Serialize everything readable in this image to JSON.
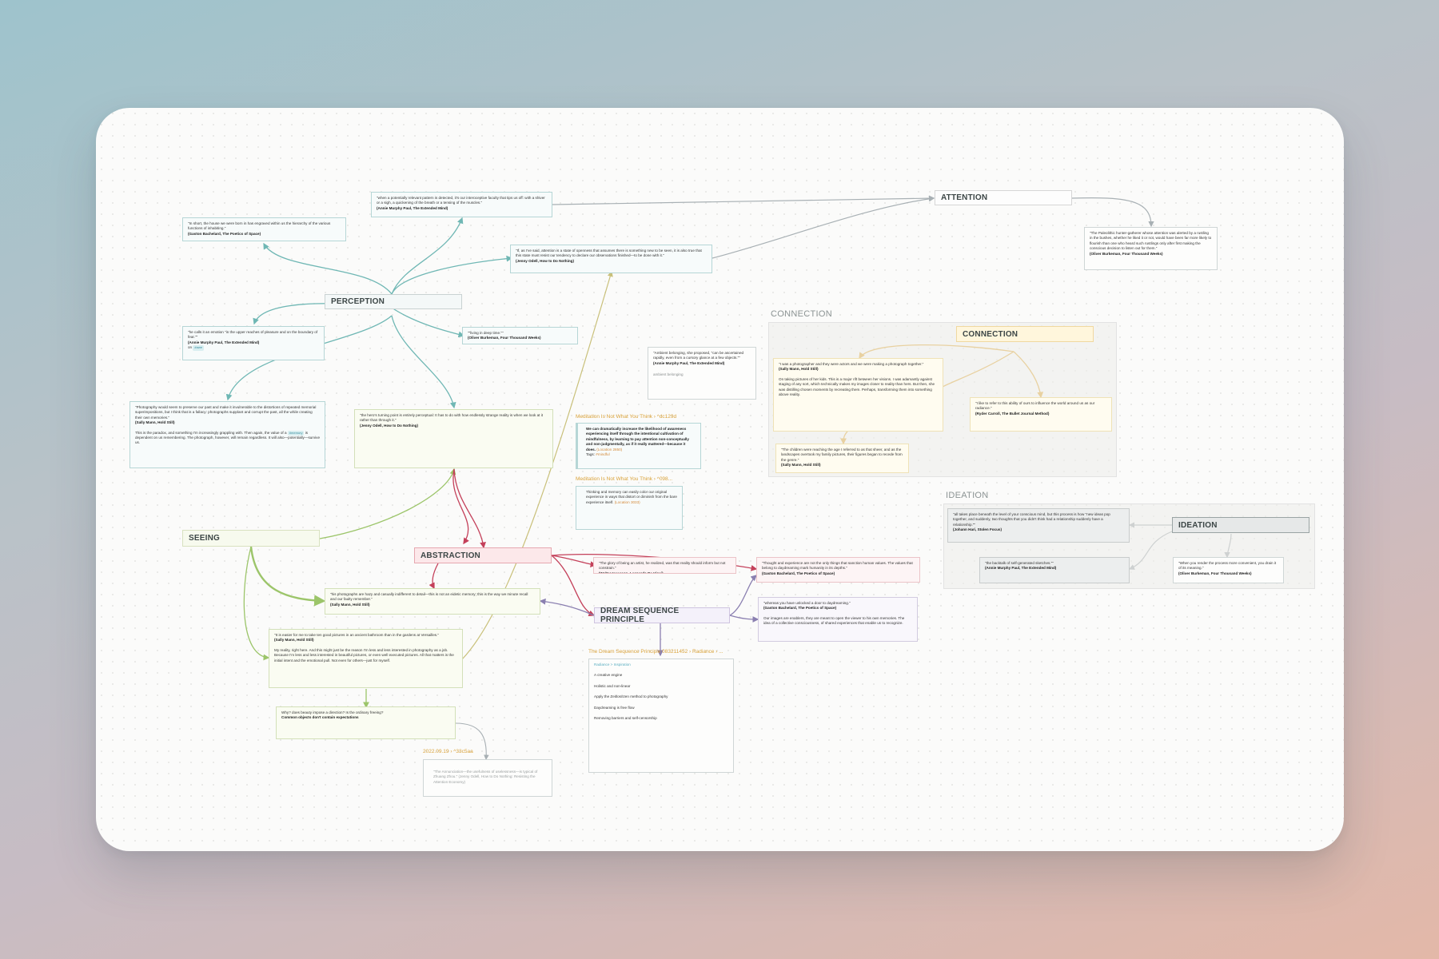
{
  "headers": {
    "attention": "ATTENTION",
    "perception": "PERCEPTION",
    "connection": "CONNECTION",
    "ideation": "IDEATION",
    "seeing": "SEEING",
    "abstraction": "ABSTRACTION",
    "dream": "DREAM SEQUENCE PRINCIPLE"
  },
  "groups": {
    "connection_label": "CONNECTION",
    "ideation_label": "IDEATION"
  },
  "file_labels": {
    "med1": "Meditation Is Not What You Think › ^dc129d",
    "med2": "Meditation Is Not What You Think › ^098...",
    "dream_file": "The Dream Sequence Principle 083211452 › Radiance › ...",
    "date_file": "2022.09.19 › ^33c5aa"
  },
  "notes": {
    "anne_detected": {
      "text": "\"when a potentially relevant pattern is detected, it's our interoceptive faculty that tips us off: with a shiver or a sigh, a quickening of the breath or a tensing of the muscles.\"",
      "src": "(Annie Murphy Paul, The Extended Mind)"
    },
    "bachelard_house": {
      "text": "\"In short, the house we were born in has engraved within us the hierarchy of the various functions of inhabiting.\"",
      "src": "(Gaston Bachelard, The Poetics of Space)"
    },
    "odell_openness": {
      "text": "\"If, as I've said, attention is a state of openness that assumes there is something new to be seen, it is also true that this state must resist our tendency to declare our observations finished—to be done with it.\"",
      "src": "(Jenny Odell, How to Do Nothing)"
    },
    "paleolithic": {
      "text": "\"The Paleolithic hunter-gatherer whose attention was alerted by a rustling in the bushes, whether he liked it or not, would have been far more likely to flourish than one who heard such rustlings only after first making the conscious decision to listen out for them.\"",
      "src": "(Oliver Burkeman, Four Thousand Weeks)"
    },
    "emotion": {
      "text": "\"he calls it an emotion \"in the upper reaches of pleasure and on the boundary of fear.\"\"",
      "src": "(Annie Murphy Paul, The Extended Mind)",
      "tag_prefix": "on",
      "tag": "#awe"
    },
    "deep_time": {
      "text": "\"\"living in deep time.\"\"",
      "src": "(Oliver Burkeman, Four Thousand Weeks)"
    },
    "ambient": {
      "text": "\"Ambient belonging, she proposed, \"can be ascertained rapidly, even from a cursory glance at a few objects.\"\"",
      "src": "(Annie Murphy Paul, The Extended Mind)",
      "extra": "ambient belonging"
    },
    "photography_preserve": {
      "text": "\"Photography would seem to preserve our past and make it invulnerable to the distortions of repeated memorial superimpositions, but I think that is a fallacy: photographs supplant and corrupt the past, all the while creating their own memories.\"",
      "src": "(Sally Mann, Hold Still)",
      "extra_before": "This is the paradox, and something I'm increasingly grappling with. Then again, the value of a",
      "tag": "#memory",
      "extra_after": "is dependent on us remembering. The photograph, however, will remain regardless. It will also—potentially—survive us."
    },
    "hero_turning": {
      "text": "\"the hero's turning point is entirely perceptual: It has to do with how endlessly strange reality is when we look at it rather than through it.\"",
      "src": "(Jenny Odell, How to Do Nothing)"
    },
    "med_dramatically": {
      "text": "We can dramatically increase the likelihood of awareness experiencing itself through the intentional cultivation of mindfulness, by learning to pay attention non-conceptually and non-judgmentally, as if it really mattered—because it does.",
      "link": "(Location 2850)",
      "tags": "Tags:",
      "tag": "#mindful"
    },
    "med_thinking": {
      "text": "Thinking and memory can easily color our original experience in ways that distort or diminish from the bare experience itself.",
      "link": "(Location 3033)"
    },
    "photographer": {
      "text": "\"I was a photographer and they were actors and we were making a photograph together.\"",
      "src": "(Sally Mann, Hold Still)",
      "extra": "On taking pictures of her kids. This is a major rift between her visions. I was adamantly against staging of any sort, which technically makes my images closer to reality than hers. But then, she was distilling chosen moments by recreating them. Perhaps, transforming them into something above reality."
    },
    "influence": {
      "text": "\"I like to refer to this ability of ours to influence the world around us as our radiance.\"",
      "src": "(Ryder Carroll, The Bullet Journal Method)"
    },
    "children": {
      "text": "\"The children were reaching the age I referred to as that sheer, and as the landscapes overtook my family pictures, their figures began to recede from the genre.\"",
      "src": "(Sally Mann, Hold Still)"
    },
    "takes_place": {
      "text": "\"all takes place beneath the level of your conscious mind, but this process is how \"new ideas pop together, and suddenly, two thoughts that you didn't think had a relationship suddenly have a relationship.\"\"",
      "src": "(Johann Hari, Stolen Focus)"
    },
    "backtalk": {
      "text": "\"the backtalk of self-generated sketches.\"\"",
      "src": "(Annie Murphy Paul, The Extended Mind)"
    },
    "render_process": {
      "text": "\"When you render the process more convenient, you drain it of its meaning.\"",
      "src": "(Oliver Burkeman, Four Thousand Weeks)"
    },
    "glory": {
      "text": "\"The glory of being an artist, he realized, was that reality should inform but not constrain.\"",
      "src": "(Walter Isaacson, Leonardo Da Vinci)"
    },
    "thought_experience": {
      "text": "\"Thought and experience are not the only things that sanction human values. The values that belong to daydreaming mark humanity in its depths.\"",
      "src": "(Gaston Bachelard, The Poetics of Space)"
    },
    "hazy": {
      "text": "\"his photographs are hazy and casually indifferent to detail—this is not an eidetic memory; this is the way we minute recall and our faulty remember.\"",
      "src": "(Sally Mann, Hold Still)"
    },
    "whereas": {
      "text": "\"whereas you have unlocked a door to daydreaming.\"",
      "src": "(Gaston Bachelard, The Poetics of Space)",
      "extra": "Our images are enablers, they are meant to open the viewer to his own memories. The idea of a collective consciousness, of shared experiences that enable us to recognize."
    },
    "easier": {
      "text": "\"It is easier for me to take ten good pictures in an ancient bathroom than in the gardens at Versailles.\"",
      "src": "(Sally Mann, Hold Still)",
      "extra": "My reality, right here. And this might just be the reason I'm less and less interested in photography as a job. Because I'm less and less interested in beautiful pictures, or even well executed pictures. All that matters is the initial intent and the emotional pull. Not even for others—just for myself."
    },
    "dream_list": {
      "title": "Radiance > Inspiration",
      "items": [
        "A creative engine",
        "Holistic and non-linear",
        "Apply the Zeitlos/Izen method to photography",
        "Daydreaming is free flow",
        "Removing barriers and self-censorship"
      ]
    },
    "beauty": {
      "text": "Why? does beauty impose a direction? Is the ordinary freeing?",
      "src": "Common objects don't contain expectations"
    },
    "date_note": {
      "text": "\"The Annunciation—the usefulness of uselessness—is typical of Zhuang Zhou.\" (Jenny Odell, How to Do Nothing: Resisting the Attention Economy)"
    }
  },
  "colors": {
    "teal": "#6fb7b4",
    "green": "#9cc56a",
    "olive": "#c9c07a",
    "red": "#c4405a",
    "purple": "#8a7fb0",
    "yellow": "#e3b04a",
    "gray": "#a8b0b4"
  }
}
